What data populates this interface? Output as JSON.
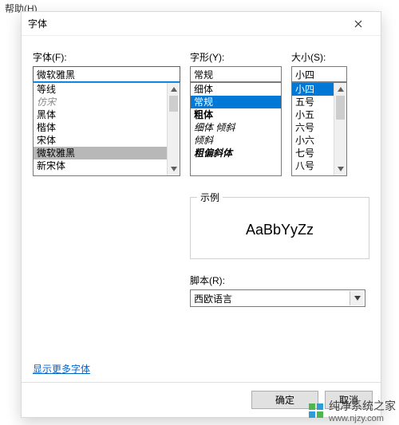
{
  "menu": {
    "help": "帮助(H)"
  },
  "dialog": {
    "title": "字体",
    "font": {
      "label": "字体(F):",
      "value": "微软雅黑",
      "items": [
        {
          "t": "等线",
          "cls": ""
        },
        {
          "t": "仿宋",
          "cls": "grey"
        },
        {
          "t": "黑体",
          "cls": ""
        },
        {
          "t": "楷体",
          "cls": ""
        },
        {
          "t": "宋体",
          "cls": ""
        },
        {
          "t": "微软雅黑",
          "cls": "sel-grey"
        },
        {
          "t": "新宋体",
          "cls": ""
        }
      ]
    },
    "style": {
      "label": "字形(Y):",
      "value": "常规",
      "items": [
        {
          "t": "细体",
          "cls": ""
        },
        {
          "t": "常规",
          "cls": "sel-blue"
        },
        {
          "t": "粗体",
          "cls": "bold"
        },
        {
          "t": "细体 倾斜",
          "cls": "italic"
        },
        {
          "t": "倾斜",
          "cls": "italic"
        },
        {
          "t": "粗偏斜体",
          "cls": "bolditalic"
        }
      ]
    },
    "size": {
      "label": "大小(S):",
      "value": "小四",
      "items": [
        {
          "t": "小四",
          "cls": "sel-blue"
        },
        {
          "t": "五号",
          "cls": ""
        },
        {
          "t": "小五",
          "cls": ""
        },
        {
          "t": "六号",
          "cls": ""
        },
        {
          "t": "小六",
          "cls": ""
        },
        {
          "t": "七号",
          "cls": ""
        },
        {
          "t": "八号",
          "cls": ""
        }
      ]
    },
    "sample": {
      "legend": "示例",
      "text": "AaBbYyZz"
    },
    "script": {
      "label": "脚本(R):",
      "value": "西欧语言"
    },
    "more_link": "显示更多字体",
    "ok": "确定",
    "cancel": "取消"
  },
  "watermark": {
    "text": "纯净系统之家",
    "url": "www.njzy.com"
  }
}
